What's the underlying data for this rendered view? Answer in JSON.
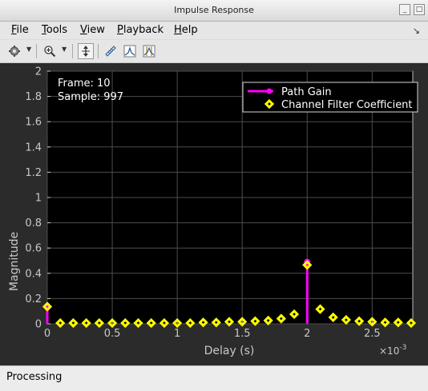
{
  "window": {
    "title": "Impulse Response"
  },
  "menu": {
    "items": [
      {
        "label": "File",
        "mnemonic": "F",
        "rest": "ile"
      },
      {
        "label": "Tools",
        "mnemonic": "T",
        "rest": "ools"
      },
      {
        "label": "View",
        "mnemonic": "V",
        "rest": "iew"
      },
      {
        "label": "Playback",
        "mnemonic": "P",
        "rest": "layback"
      },
      {
        "label": "Help",
        "mnemonic": "H",
        "rest": "elp"
      }
    ]
  },
  "toolbar": {
    "icons": [
      "settings-gear-icon",
      "zoom-in-icon",
      "autoscale-icon",
      "ruler-icon",
      "signal-peak-icon",
      "bandwidth-icon"
    ]
  },
  "plot": {
    "info": {
      "frame": "Frame: 10",
      "sample": "Sample: 997"
    },
    "legend": [
      "Path Gain",
      "Channel Filter Coefficient"
    ],
    "axis": {
      "xlabel": "Delay (s)",
      "ylabel": "Magnitude",
      "xscale": "×10",
      "xscale_exp": "-3"
    }
  },
  "chart_data": {
    "type": "scatter",
    "title": "",
    "xlabel": "Delay (s)",
    "ylabel": "Magnitude",
    "x_multiplier": "1e-3",
    "xlim": [
      0,
      0.0028125
    ],
    "ylim": [
      0,
      2
    ],
    "xticks": [
      0,
      0.5,
      1,
      1.5,
      2,
      2.5
    ],
    "yticks": [
      0,
      0.2,
      0.4,
      0.6,
      0.8,
      1,
      1.2,
      1.4,
      1.6,
      1.8,
      2
    ],
    "grid": true,
    "legend_position": "top-right",
    "colors": {
      "path_gain": "#ff00ff",
      "coefficient": "#ffff00",
      "background": "#000000",
      "panel": "#2b2b2b"
    },
    "series": [
      {
        "name": "Path Gain",
        "style": "stem",
        "x": [
          0,
          0.002
        ],
        "values": [
          0.13,
          0.49
        ]
      },
      {
        "name": "Channel Filter Coefficient",
        "style": "markers",
        "x": [
          0,
          0.0001,
          0.0002,
          0.0003,
          0.0004,
          0.0005,
          0.0006,
          0.0007,
          0.0008,
          0.0009,
          0.001,
          0.0011,
          0.0012,
          0.0013,
          0.0014,
          0.0015,
          0.0016,
          0.0017,
          0.0018,
          0.0019,
          0.002,
          0.0021,
          0.0022,
          0.0023,
          0.0024,
          0.0025,
          0.0026,
          0.0027,
          0.0028
        ],
        "values": [
          0.13,
          0.0,
          0.0,
          0.0,
          0.0,
          0.0,
          0.0,
          0.0,
          0.0,
          0.0,
          0.0,
          0.0,
          0.005,
          0.005,
          0.01,
          0.01,
          0.015,
          0.02,
          0.035,
          0.07,
          0.46,
          0.11,
          0.045,
          0.025,
          0.015,
          0.01,
          0.005,
          0.005,
          0.0
        ]
      }
    ]
  },
  "status": {
    "text": "Processing"
  }
}
